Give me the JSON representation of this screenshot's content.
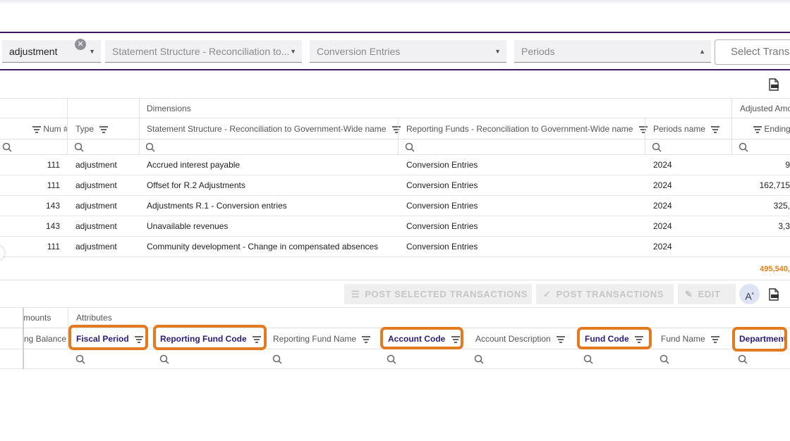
{
  "filters": {
    "type_value": "adjustment",
    "statement_placeholder": "Statement Structure - Reconciliation to...",
    "funds_placeholder": "Conversion Entries",
    "periods_placeholder": "Periods",
    "select_transactions_label": "Select Transa"
  },
  "grid": {
    "group_dimensions": "Dimensions",
    "group_adjusted": "Adjusted Amo",
    "columns": {
      "num": "Num #",
      "type": "Type",
      "statement": "Statement Structure - Reconciliation to Government-Wide name",
      "funds": "Reporting Funds - Reconciliation to Government-Wide name",
      "periods": "Periods name",
      "ending": "Ending B"
    },
    "rows": [
      {
        "num": "111",
        "type": "adjustment",
        "statement": "Accrued interest payable",
        "funds": "Conversion Entries",
        "period": "2024",
        "ending": "9"
      },
      {
        "num": "111",
        "type": "adjustment",
        "statement": "Offset for R.2 Adjustments",
        "funds": "Conversion Entries",
        "period": "2024",
        "ending": "162,715"
      },
      {
        "num": "143",
        "type": "adjustment",
        "statement": "Adjustments R.1 - Conversion entries",
        "funds": "Conversion Entries",
        "period": "2024",
        "ending": "325,"
      },
      {
        "num": "143",
        "type": "adjustment",
        "statement": "Unavailable revenues",
        "funds": "Conversion Entries",
        "period": "2024",
        "ending": "3,3"
      },
      {
        "num": "111",
        "type": "adjustment",
        "statement": "Community development - Change in compensated absences",
        "funds": "Conversion Entries",
        "period": "2024",
        "ending": ""
      }
    ],
    "total": "495,540,"
  },
  "actions": {
    "post_selected": "POST SELECTED TRANSACTIONS",
    "post": "POST TRANSACTIONS",
    "edit": "EDIT",
    "font_size_label": "A"
  },
  "attributes": {
    "group_amounts": "mounts",
    "group_attributes": "Attributes",
    "columns": {
      "ending_balance": "ng Balance",
      "fiscal_period": "Fiscal Period",
      "reporting_fund_code": "Reporting Fund Code",
      "reporting_fund_name": "Reporting Fund Name",
      "account_code": "Account Code",
      "account_description": "Account Description",
      "fund_code": "Fund Code",
      "fund_name": "Fund Name",
      "department": "Department"
    }
  },
  "colors": {
    "accent_border": "#3c1a5e",
    "highlight": "#e37a20",
    "total_text": "#e27d16"
  }
}
